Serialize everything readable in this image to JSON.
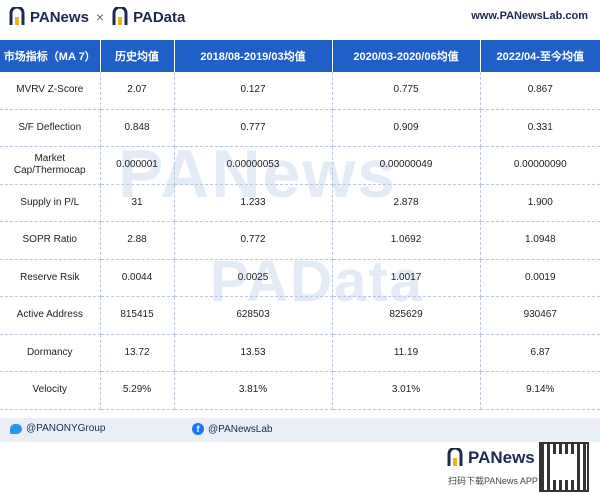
{
  "header": {
    "brand_left": "PANews",
    "brand_sep": "×",
    "brand_right": "PAData",
    "site": "www.PANewsLab.com"
  },
  "watermarks": [
    "PANews",
    "PAData"
  ],
  "table": {
    "columns": [
      "市场指标（MA 7）",
      "历史均值",
      "2018/08-2019/03均值",
      "2020/03-2020/06均值",
      "2022/04-至今均值"
    ],
    "rows": [
      [
        "MVRV Z-Score",
        "2.07",
        "0.127",
        "0.775",
        "0.867"
      ],
      [
        "S/F Deflection",
        "0.848",
        "0.777",
        "0.909",
        "0.331"
      ],
      [
        "Market Cap/Thermocap",
        "0.000001",
        "0.00000053",
        "0.00000049",
        "0.00000090"
      ],
      [
        "Supply in P/L",
        "31",
        "1.233",
        "2.878",
        "1.900"
      ],
      [
        "SOPR Ratio",
        "2.88",
        "0.772",
        "1.0692",
        "1.0948"
      ],
      [
        "Reserve Rsik",
        "0.0044",
        "0.0025",
        "1.0017",
        "0.0019"
      ],
      [
        "Active Address",
        "815415",
        "628503",
        "825629",
        "930467"
      ],
      [
        "Dormancy",
        "13.72",
        "13.53",
        "11.19",
        "6.87"
      ],
      [
        "Velocity",
        "5.29%",
        "3.81%",
        "3.01%",
        "9.14%"
      ]
    ]
  },
  "footer": {
    "twitter": "@PANONYGroup",
    "facebook": "@PANewsLab",
    "logo": "PANews",
    "scan_text": "扫码下载PANews APP"
  },
  "colors": {
    "header_bg": "#1f5fc7",
    "brand_text": "#1b2a4e",
    "footer_bg": "#e9eef7",
    "watermark": "#e3ebf7"
  }
}
